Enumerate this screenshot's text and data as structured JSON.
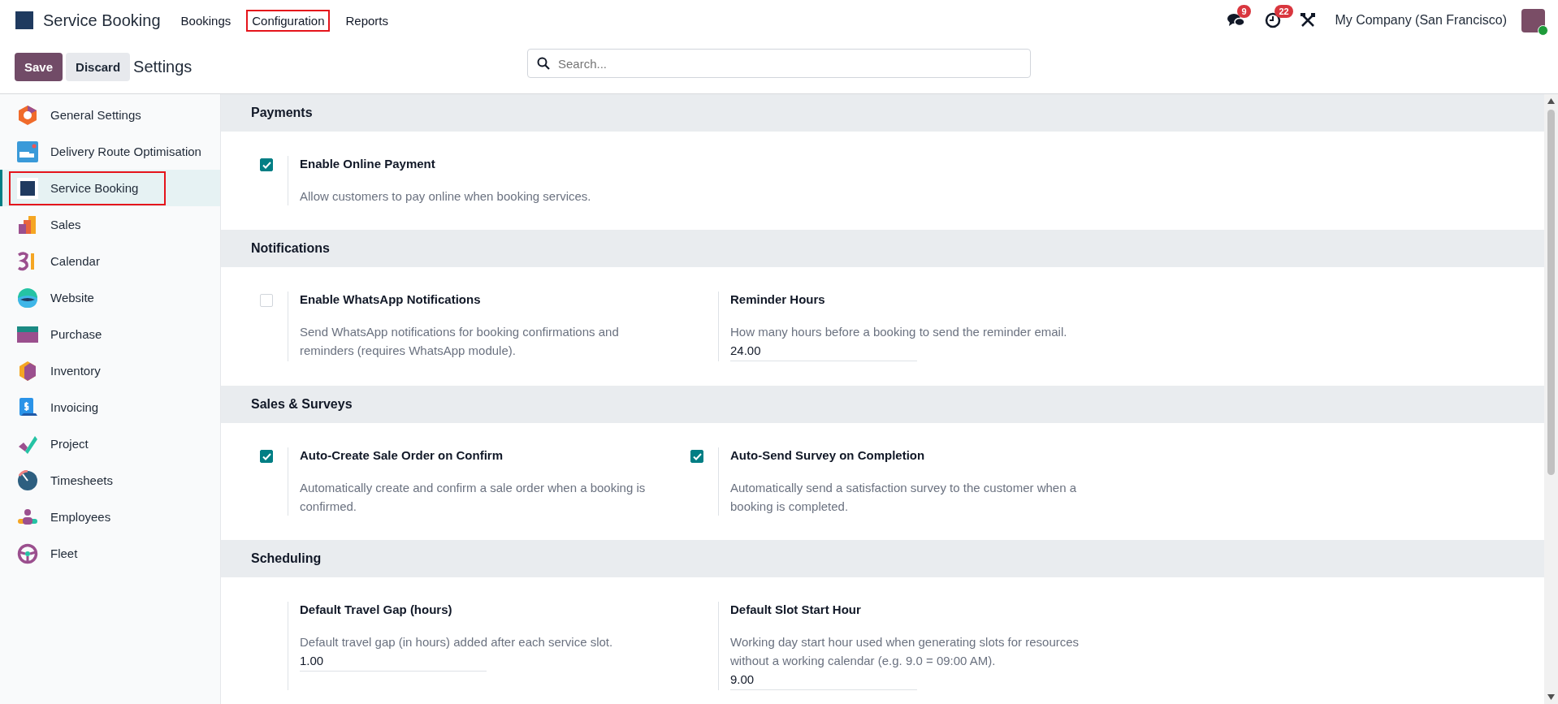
{
  "navbar": {
    "app_name": "Service Booking",
    "menu": [
      {
        "label": "Bookings",
        "highlighted": false
      },
      {
        "label": "Configuration",
        "highlighted": true
      },
      {
        "label": "Reports",
        "highlighted": false
      }
    ],
    "messages_count": "9",
    "activities_count": "22",
    "company": "My Company (San Francisco)"
  },
  "control_panel": {
    "save": "Save",
    "discard": "Discard",
    "title": "Settings",
    "search": {
      "placeholder": "Search..."
    }
  },
  "sidebar": {
    "items": [
      {
        "label": "General Settings",
        "selected": false,
        "highlighted": false
      },
      {
        "label": "Delivery Route Optimisation",
        "selected": false,
        "highlighted": false
      },
      {
        "label": "Service Booking",
        "selected": true,
        "highlighted": true
      },
      {
        "label": "Sales",
        "selected": false,
        "highlighted": false
      },
      {
        "label": "Calendar",
        "selected": false,
        "highlighted": false
      },
      {
        "label": "Website",
        "selected": false,
        "highlighted": false
      },
      {
        "label": "Purchase",
        "selected": false,
        "highlighted": false
      },
      {
        "label": "Inventory",
        "selected": false,
        "highlighted": false
      },
      {
        "label": "Invoicing",
        "selected": false,
        "highlighted": false
      },
      {
        "label": "Project",
        "selected": false,
        "highlighted": false
      },
      {
        "label": "Timesheets",
        "selected": false,
        "highlighted": false
      },
      {
        "label": "Employees",
        "selected": false,
        "highlighted": false
      },
      {
        "label": "Fleet",
        "selected": false,
        "highlighted": false
      }
    ]
  },
  "sections": [
    {
      "title": "Payments",
      "settings": [
        {
          "kind": "checkbox",
          "label": "Enable Online Payment",
          "checked": true,
          "description": "Allow customers to pay online when booking services."
        }
      ]
    },
    {
      "title": "Notifications",
      "settings": [
        {
          "kind": "checkbox",
          "label": "Enable WhatsApp Notifications",
          "checked": false,
          "description": "Send WhatsApp notifications for booking confirmations and reminders (requires WhatsApp module)."
        },
        {
          "kind": "field",
          "label": "Reminder Hours",
          "description": "How many hours before a booking to send the reminder email.",
          "value": "24.00"
        }
      ]
    },
    {
      "title": "Sales & Surveys",
      "settings": [
        {
          "kind": "checkbox",
          "label": "Auto-Create Sale Order on Confirm",
          "checked": true,
          "description": "Automatically create and confirm a sale order when a booking is confirmed."
        },
        {
          "kind": "checkbox",
          "label": "Auto-Send Survey on Completion",
          "checked": true,
          "description": "Automatically send a satisfaction survey to the customer when a booking is completed."
        }
      ]
    },
    {
      "title": "Scheduling",
      "settings": [
        {
          "kind": "field",
          "label": "Default Travel Gap (hours)",
          "description": "Default travel gap (in hours) added after each service slot.",
          "value": "1.00"
        },
        {
          "kind": "field",
          "label": "Default Slot Start Hour",
          "description": "Working day start hour used when generating slots for resources without a working calendar (e.g. 9.0 = 09:00 AM).",
          "value": "9.00"
        }
      ]
    }
  ]
}
